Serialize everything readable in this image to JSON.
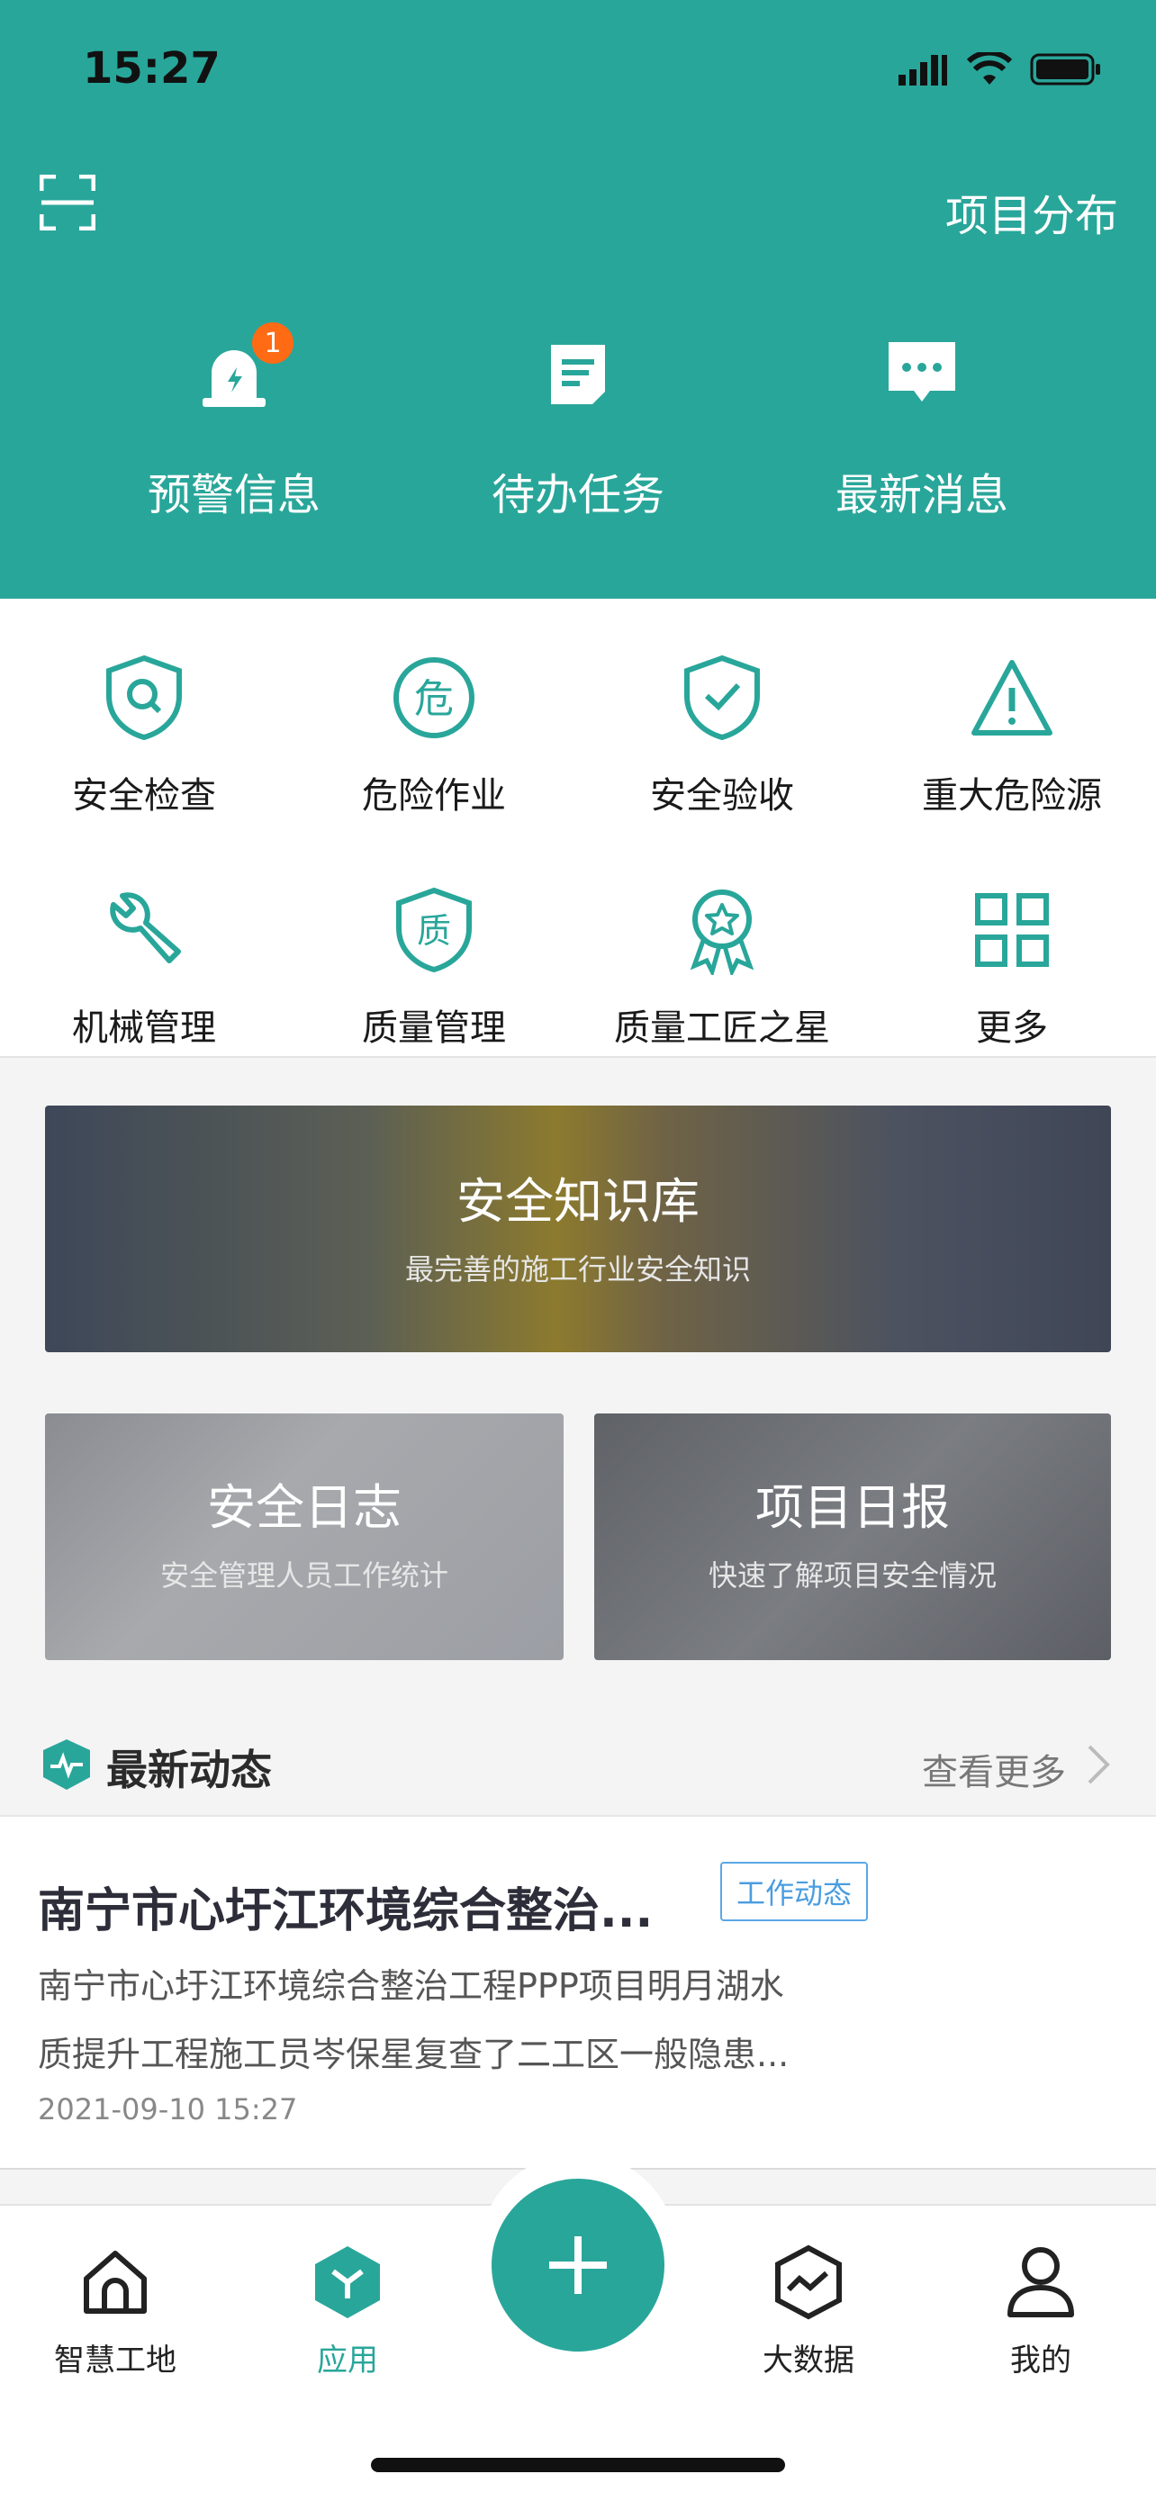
{
  "status": {
    "time": "15:27"
  },
  "header": {
    "project_distribution": "项目分布",
    "actions": [
      {
        "label": "预警信息",
        "icon": "alarm-icon",
        "badge": "1"
      },
      {
        "label": "待办任务",
        "icon": "task-icon"
      },
      {
        "label": "最新消息",
        "icon": "message-icon"
      }
    ]
  },
  "grid": [
    {
      "label": "安全检查",
      "icon": "shield-search-icon"
    },
    {
      "label": "危险作业",
      "icon": "danger-icon",
      "glyph": "危"
    },
    {
      "label": "安全验收",
      "icon": "shield-check-icon"
    },
    {
      "label": "重大危险源",
      "icon": "warning-triangle-icon"
    },
    {
      "label": "机械管理",
      "icon": "wrench-icon"
    },
    {
      "label": "质量管理",
      "icon": "quality-shield-icon",
      "glyph": "质"
    },
    {
      "label": "质量工匠之星",
      "icon": "award-star-icon"
    },
    {
      "label": "更多",
      "icon": "grid-icon"
    }
  ],
  "banners": {
    "main": {
      "title": "安全知识库",
      "subtitle": "最完善的施工行业安全知识"
    },
    "left": {
      "title": "安全日志",
      "subtitle": "安全管理人员工作统计"
    },
    "right": {
      "title": "项目日报",
      "subtitle": "快速了解项目安全情况"
    }
  },
  "section": {
    "title": "最新动态",
    "more": "查看更多"
  },
  "news": [
    {
      "title": "南宁市心圩江环境综合整治...",
      "tag": "工作动态",
      "body_line1": "南宁市心圩江环境综合整治工程PPP项目明月湖水",
      "body_line2": "质提升工程施工员岑保星复查了二工区一般隐患...",
      "date": "2021-09-10 15:27"
    }
  ],
  "tabbar": [
    {
      "label": "智慧工地",
      "icon": "home-icon"
    },
    {
      "label": "应用",
      "icon": "apps-icon",
      "active": true
    },
    {
      "label": "大数据",
      "icon": "chart-icon"
    },
    {
      "label": "我的",
      "icon": "user-icon"
    }
  ],
  "colors": {
    "primary": "#29a69a",
    "badge": "#ff6a14",
    "tag": "#4a9de0"
  }
}
